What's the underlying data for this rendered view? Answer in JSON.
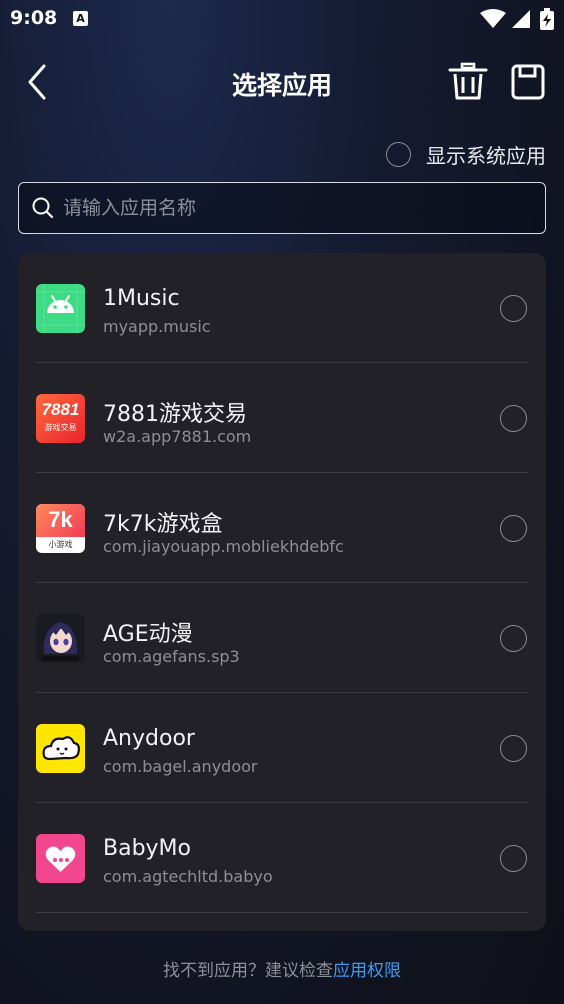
{
  "status_bar": {
    "time": "9:08",
    "notification_badge": "A"
  },
  "header": {
    "title": "选择应用",
    "back_icon": "chevron-left-icon",
    "trash_icon": "trash-icon",
    "save_icon": "floppy-save-icon"
  },
  "system_apps_toggle": {
    "label": "显示系统应用",
    "checked": false
  },
  "search": {
    "placeholder": "请输入应用名称",
    "value": ""
  },
  "apps": [
    {
      "name": "1Music",
      "package": "myapp.music",
      "icon": "android-icon",
      "selected": false
    },
    {
      "name": "7881游戏交易",
      "package": "w2a.app7881.com",
      "icon": "app-7881-icon",
      "icon_text": "7881",
      "icon_subtext": "游戏交易",
      "selected": false
    },
    {
      "name": "7k7k游戏盒",
      "package": "com.jiayouapp.mobliekhdebfc",
      "icon": "app-7k7k-icon",
      "icon_text": "7k",
      "icon_subtext": "小游戏",
      "selected": false
    },
    {
      "name": "AGE动漫",
      "package": "com.agefans.sp3",
      "icon": "anime-character-icon",
      "selected": false
    },
    {
      "name": "Anydoor",
      "package": "com.bagel.anydoor",
      "icon": "cloud-face-icon",
      "selected": false
    },
    {
      "name": "BabyMo",
      "package": "com.agtechltd.babyo",
      "icon": "heart-bubble-icon",
      "selected": false
    }
  ],
  "footer": {
    "text": "找不到应用？建议检查",
    "link": "应用权限"
  },
  "colors": {
    "accent_link": "#3d9bf4",
    "card": "#232128",
    "android_green": "#3ddc84",
    "anydoor_yellow": "#ffe600",
    "babymo_pink": "#f2478f"
  }
}
